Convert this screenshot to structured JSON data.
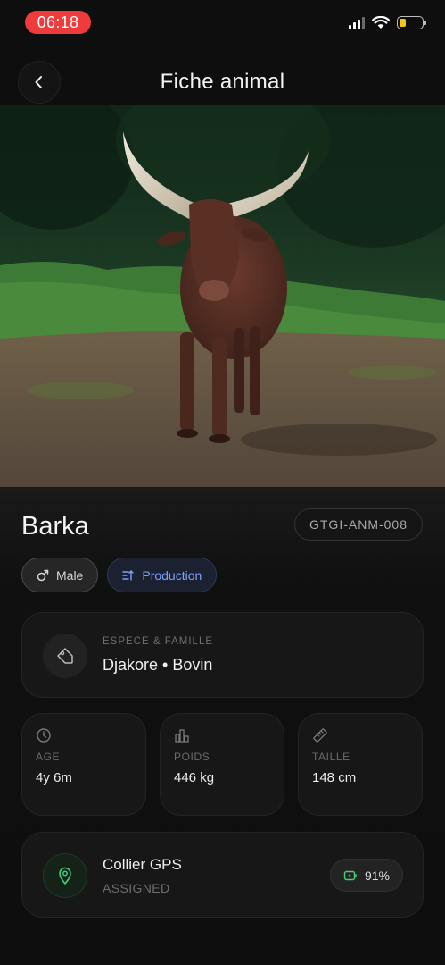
{
  "status_bar": {
    "time": "06:18",
    "battery_level": 0.3,
    "signal_bars": 4,
    "signal_active": 3,
    "colors": {
      "time_pill": "#ef3b3b",
      "battery": "#f5c518"
    }
  },
  "header": {
    "title": "Fiche animal",
    "back_icon": "chevron-left-icon"
  },
  "hero": {
    "subject": "ankole-watusi-bull-photo"
  },
  "animal": {
    "name": "Barka",
    "id": "GTGI-ANM-008",
    "sex": {
      "label": "Male",
      "icon": "male-symbol-icon"
    },
    "purpose": {
      "label": "Production",
      "icon": "sliders-icon",
      "color": "#7aa2ff"
    },
    "species": {
      "label": "ESPECE & FAMILLE",
      "value": "Djakore • Bovin",
      "icon": "tag-icon"
    },
    "stats": [
      {
        "key": "age",
        "label": "AGE",
        "value": "4y 6m",
        "icon": "clock-icon"
      },
      {
        "key": "weight",
        "label": "POIDS",
        "value": "446 kg",
        "icon": "bar-chart-icon"
      },
      {
        "key": "height",
        "label": "TAILLE",
        "value": "148 cm",
        "icon": "ruler-icon"
      }
    ]
  },
  "gps": {
    "title": "Collier GPS",
    "status": "ASSIGNED",
    "battery": "91%",
    "icon": "location-pin-icon",
    "battery_icon": "battery-charging-icon",
    "color": "#3fd07a"
  }
}
